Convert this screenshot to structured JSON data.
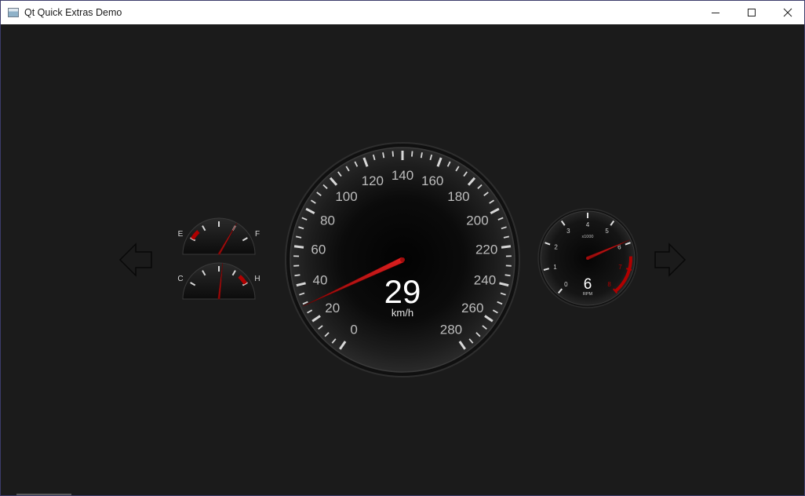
{
  "window": {
    "title": "Qt Quick Extras Demo"
  },
  "speedometer": {
    "value": 29,
    "unit": "km/h",
    "min": 0,
    "max": 280,
    "label_step": 20,
    "labels": [
      "0",
      "20",
      "40",
      "60",
      "80",
      "100",
      "120",
      "140",
      "160",
      "180",
      "200",
      "220",
      "240",
      "260",
      "280"
    ]
  },
  "fuel_gauge": {
    "empty_label": "E",
    "full_label": "F",
    "level": 0.75
  },
  "temp_gauge": {
    "cold_label": "C",
    "hot_label": "H",
    "level": 0.55
  },
  "tachometer": {
    "value": 6,
    "unit": "RPM",
    "scale_label": "x1000",
    "needle_value": 5.9,
    "labels": [
      "0",
      "1",
      "2",
      "3",
      "4",
      "5",
      "6",
      "7",
      "8"
    ],
    "redline_from": 6.5
  },
  "nav": {
    "prev_icon": "arrow-left-icon",
    "next_icon": "arrow-right-icon"
  },
  "colors": {
    "background": "#1b1b1b",
    "needle": "#c81515",
    "redzone": "#b00000",
    "tick": "#d8d8d8",
    "label": "#bdbdbd"
  }
}
